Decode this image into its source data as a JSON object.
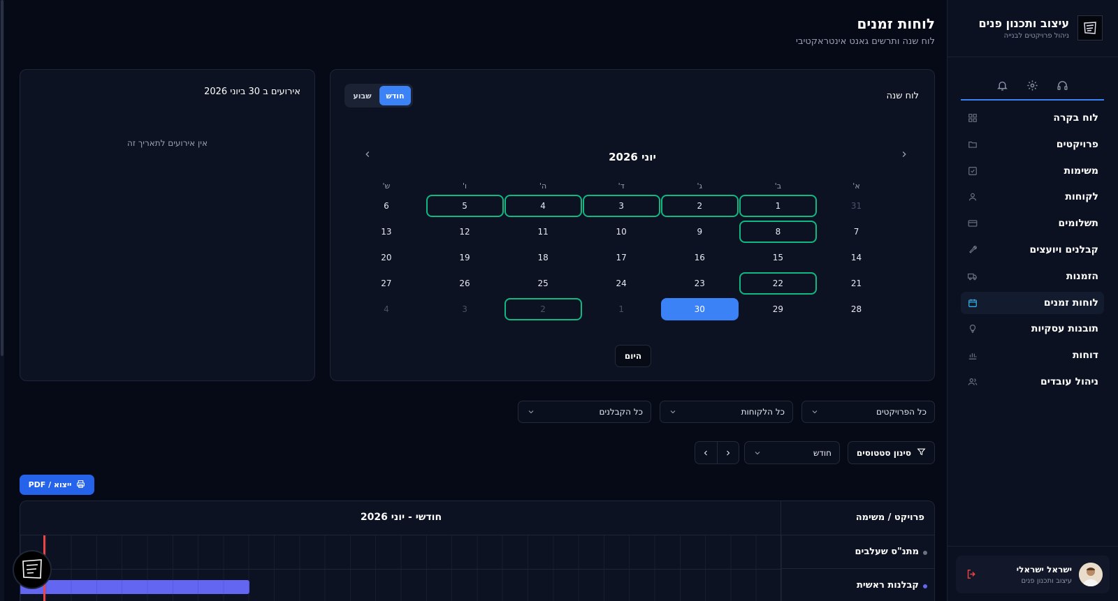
{
  "brand": {
    "title": "עיצוב ותכנון פנים",
    "subtitle": "ניהול פרויקטים לבנייה",
    "logo_icon": "frame-logo-icon"
  },
  "sidebar_icons": [
    "bell-icon",
    "gear-icon",
    "headset-icon"
  ],
  "nav": [
    {
      "label": "לוח בקרה",
      "icon": "grid-icon"
    },
    {
      "label": "פרויקטים",
      "icon": "folder-icon"
    },
    {
      "label": "משימות",
      "icon": "checkbox-icon"
    },
    {
      "label": "לקוחות",
      "icon": "user-icon"
    },
    {
      "label": "תשלומים",
      "icon": "credit-card-icon"
    },
    {
      "label": "קבלנים ויועצים",
      "icon": "wrench-icon"
    },
    {
      "label": "הזמנות",
      "icon": "truck-icon"
    },
    {
      "label": "לוחות זמנים",
      "icon": "calendar-icon",
      "active": true
    },
    {
      "label": "תובנות עסקיות",
      "icon": "lightbulb-icon"
    },
    {
      "label": "דוחות",
      "icon": "bar-chart-icon"
    },
    {
      "label": "ניהול עובדים",
      "icon": "users-icon"
    }
  ],
  "user": {
    "name": "ישראל ישראלי",
    "role": "עיצוב ותכנון פנים"
  },
  "header": {
    "title": "לוחות זמנים",
    "subtitle": "לוח שנה ותרשים גאנט אינטראקטיבי"
  },
  "events": {
    "title": "אירועים ב 30 ביוני 2026",
    "empty": "אין אירועים לתאריך זה"
  },
  "calendar": {
    "title": "לוח שנה",
    "view_month": "חודש",
    "view_week": "שבוע",
    "month_label": "יוני 2026",
    "weekdays": [
      "א'",
      "ב'",
      "ג'",
      "ד'",
      "ה'",
      "ו'",
      "ש'"
    ],
    "weeks": [
      [
        "31",
        "1",
        "2",
        "3",
        "4",
        "5",
        "6"
      ],
      [
        "7",
        "8",
        "9",
        "10",
        "11",
        "12",
        "13"
      ],
      [
        "14",
        "15",
        "16",
        "17",
        "18",
        "19",
        "20"
      ],
      [
        "21",
        "22",
        "23",
        "24",
        "25",
        "26",
        "27"
      ],
      [
        "28",
        "29",
        "30",
        "1",
        "2",
        "3",
        "4"
      ]
    ],
    "muted": [
      "0-0",
      "4-3",
      "4-4",
      "4-5",
      "4-6"
    ],
    "event_days": [
      "0-1",
      "0-2",
      "0-3",
      "0-4",
      "0-5",
      "1-1",
      "3-1",
      "4-4"
    ],
    "selected": "4-2",
    "today_label": "היום",
    "event_color": "#10b981",
    "selected_color": "#3b82f6"
  },
  "filters": {
    "projects": "כל הפרויקטים",
    "clients": "כל הלקוחות",
    "contractors": "כל הקבלנים",
    "status_filter": "סינון סטטוסים",
    "period": "חודש"
  },
  "export_label": "ייצוא / PDF",
  "gantt": {
    "column_header": "פרויקט / משימה",
    "timeline_header": "חודשי - יוני 2026",
    "rows": [
      {
        "label": "מתנ\"ס שעלבים",
        "dot_color": "#6b7280"
      },
      {
        "label": "קבלנות ראשית",
        "dot_color": "#6366f1"
      }
    ],
    "bar_color": "#6366f1",
    "today_color": "#ef4444"
  }
}
